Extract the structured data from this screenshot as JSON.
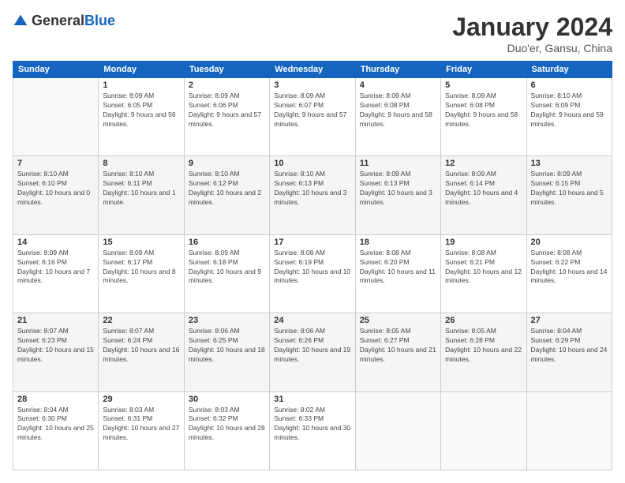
{
  "logo": {
    "general": "General",
    "blue": "Blue"
  },
  "header": {
    "month": "January 2024",
    "location": "Duo'er, Gansu, China"
  },
  "weekdays": [
    "Sunday",
    "Monday",
    "Tuesday",
    "Wednesday",
    "Thursday",
    "Friday",
    "Saturday"
  ],
  "weeks": [
    [
      {
        "day": "",
        "sunrise": "",
        "sunset": "",
        "daylight": ""
      },
      {
        "day": "1",
        "sunrise": "Sunrise: 8:09 AM",
        "sunset": "Sunset: 6:05 PM",
        "daylight": "Daylight: 9 hours and 56 minutes."
      },
      {
        "day": "2",
        "sunrise": "Sunrise: 8:09 AM",
        "sunset": "Sunset: 6:06 PM",
        "daylight": "Daylight: 9 hours and 57 minutes."
      },
      {
        "day": "3",
        "sunrise": "Sunrise: 8:09 AM",
        "sunset": "Sunset: 6:07 PM",
        "daylight": "Daylight: 9 hours and 57 minutes."
      },
      {
        "day": "4",
        "sunrise": "Sunrise: 8:09 AM",
        "sunset": "Sunset: 6:08 PM",
        "daylight": "Daylight: 9 hours and 58 minutes."
      },
      {
        "day": "5",
        "sunrise": "Sunrise: 8:09 AM",
        "sunset": "Sunset: 6:08 PM",
        "daylight": "Daylight: 9 hours and 58 minutes."
      },
      {
        "day": "6",
        "sunrise": "Sunrise: 8:10 AM",
        "sunset": "Sunset: 6:09 PM",
        "daylight": "Daylight: 9 hours and 59 minutes."
      }
    ],
    [
      {
        "day": "7",
        "sunrise": "Sunrise: 8:10 AM",
        "sunset": "Sunset: 6:10 PM",
        "daylight": "Daylight: 10 hours and 0 minutes."
      },
      {
        "day": "8",
        "sunrise": "Sunrise: 8:10 AM",
        "sunset": "Sunset: 6:11 PM",
        "daylight": "Daylight: 10 hours and 1 minute."
      },
      {
        "day": "9",
        "sunrise": "Sunrise: 8:10 AM",
        "sunset": "Sunset: 6:12 PM",
        "daylight": "Daylight: 10 hours and 2 minutes."
      },
      {
        "day": "10",
        "sunrise": "Sunrise: 8:10 AM",
        "sunset": "Sunset: 6:13 PM",
        "daylight": "Daylight: 10 hours and 3 minutes."
      },
      {
        "day": "11",
        "sunrise": "Sunrise: 8:09 AM",
        "sunset": "Sunset: 6:13 PM",
        "daylight": "Daylight: 10 hours and 3 minutes."
      },
      {
        "day": "12",
        "sunrise": "Sunrise: 8:09 AM",
        "sunset": "Sunset: 6:14 PM",
        "daylight": "Daylight: 10 hours and 4 minutes."
      },
      {
        "day": "13",
        "sunrise": "Sunrise: 8:09 AM",
        "sunset": "Sunset: 6:15 PM",
        "daylight": "Daylight: 10 hours and 5 minutes."
      }
    ],
    [
      {
        "day": "14",
        "sunrise": "Sunrise: 8:09 AM",
        "sunset": "Sunset: 6:16 PM",
        "daylight": "Daylight: 10 hours and 7 minutes."
      },
      {
        "day": "15",
        "sunrise": "Sunrise: 8:09 AM",
        "sunset": "Sunset: 6:17 PM",
        "daylight": "Daylight: 10 hours and 8 minutes."
      },
      {
        "day": "16",
        "sunrise": "Sunrise: 8:09 AM",
        "sunset": "Sunset: 6:18 PM",
        "daylight": "Daylight: 10 hours and 9 minutes."
      },
      {
        "day": "17",
        "sunrise": "Sunrise: 8:08 AM",
        "sunset": "Sunset: 6:19 PM",
        "daylight": "Daylight: 10 hours and 10 minutes."
      },
      {
        "day": "18",
        "sunrise": "Sunrise: 8:08 AM",
        "sunset": "Sunset: 6:20 PM",
        "daylight": "Daylight: 10 hours and 11 minutes."
      },
      {
        "day": "19",
        "sunrise": "Sunrise: 8:08 AM",
        "sunset": "Sunset: 6:21 PM",
        "daylight": "Daylight: 10 hours and 12 minutes."
      },
      {
        "day": "20",
        "sunrise": "Sunrise: 8:08 AM",
        "sunset": "Sunset: 6:22 PM",
        "daylight": "Daylight: 10 hours and 14 minutes."
      }
    ],
    [
      {
        "day": "21",
        "sunrise": "Sunrise: 8:07 AM",
        "sunset": "Sunset: 6:23 PM",
        "daylight": "Daylight: 10 hours and 15 minutes."
      },
      {
        "day": "22",
        "sunrise": "Sunrise: 8:07 AM",
        "sunset": "Sunset: 6:24 PM",
        "daylight": "Daylight: 10 hours and 16 minutes."
      },
      {
        "day": "23",
        "sunrise": "Sunrise: 8:06 AM",
        "sunset": "Sunset: 6:25 PM",
        "daylight": "Daylight: 10 hours and 18 minutes."
      },
      {
        "day": "24",
        "sunrise": "Sunrise: 8:06 AM",
        "sunset": "Sunset: 6:26 PM",
        "daylight": "Daylight: 10 hours and 19 minutes."
      },
      {
        "day": "25",
        "sunrise": "Sunrise: 8:05 AM",
        "sunset": "Sunset: 6:27 PM",
        "daylight": "Daylight: 10 hours and 21 minutes."
      },
      {
        "day": "26",
        "sunrise": "Sunrise: 8:05 AM",
        "sunset": "Sunset: 6:28 PM",
        "daylight": "Daylight: 10 hours and 22 minutes."
      },
      {
        "day": "27",
        "sunrise": "Sunrise: 8:04 AM",
        "sunset": "Sunset: 6:29 PM",
        "daylight": "Daylight: 10 hours and 24 minutes."
      }
    ],
    [
      {
        "day": "28",
        "sunrise": "Sunrise: 8:04 AM",
        "sunset": "Sunset: 6:30 PM",
        "daylight": "Daylight: 10 hours and 25 minutes."
      },
      {
        "day": "29",
        "sunrise": "Sunrise: 8:03 AM",
        "sunset": "Sunset: 6:31 PM",
        "daylight": "Daylight: 10 hours and 27 minutes."
      },
      {
        "day": "30",
        "sunrise": "Sunrise: 8:03 AM",
        "sunset": "Sunset: 6:32 PM",
        "daylight": "Daylight: 10 hours and 28 minutes."
      },
      {
        "day": "31",
        "sunrise": "Sunrise: 8:02 AM",
        "sunset": "Sunset: 6:33 PM",
        "daylight": "Daylight: 10 hours and 30 minutes."
      },
      {
        "day": "",
        "sunrise": "",
        "sunset": "",
        "daylight": ""
      },
      {
        "day": "",
        "sunrise": "",
        "sunset": "",
        "daylight": ""
      },
      {
        "day": "",
        "sunrise": "",
        "sunset": "",
        "daylight": ""
      }
    ]
  ]
}
